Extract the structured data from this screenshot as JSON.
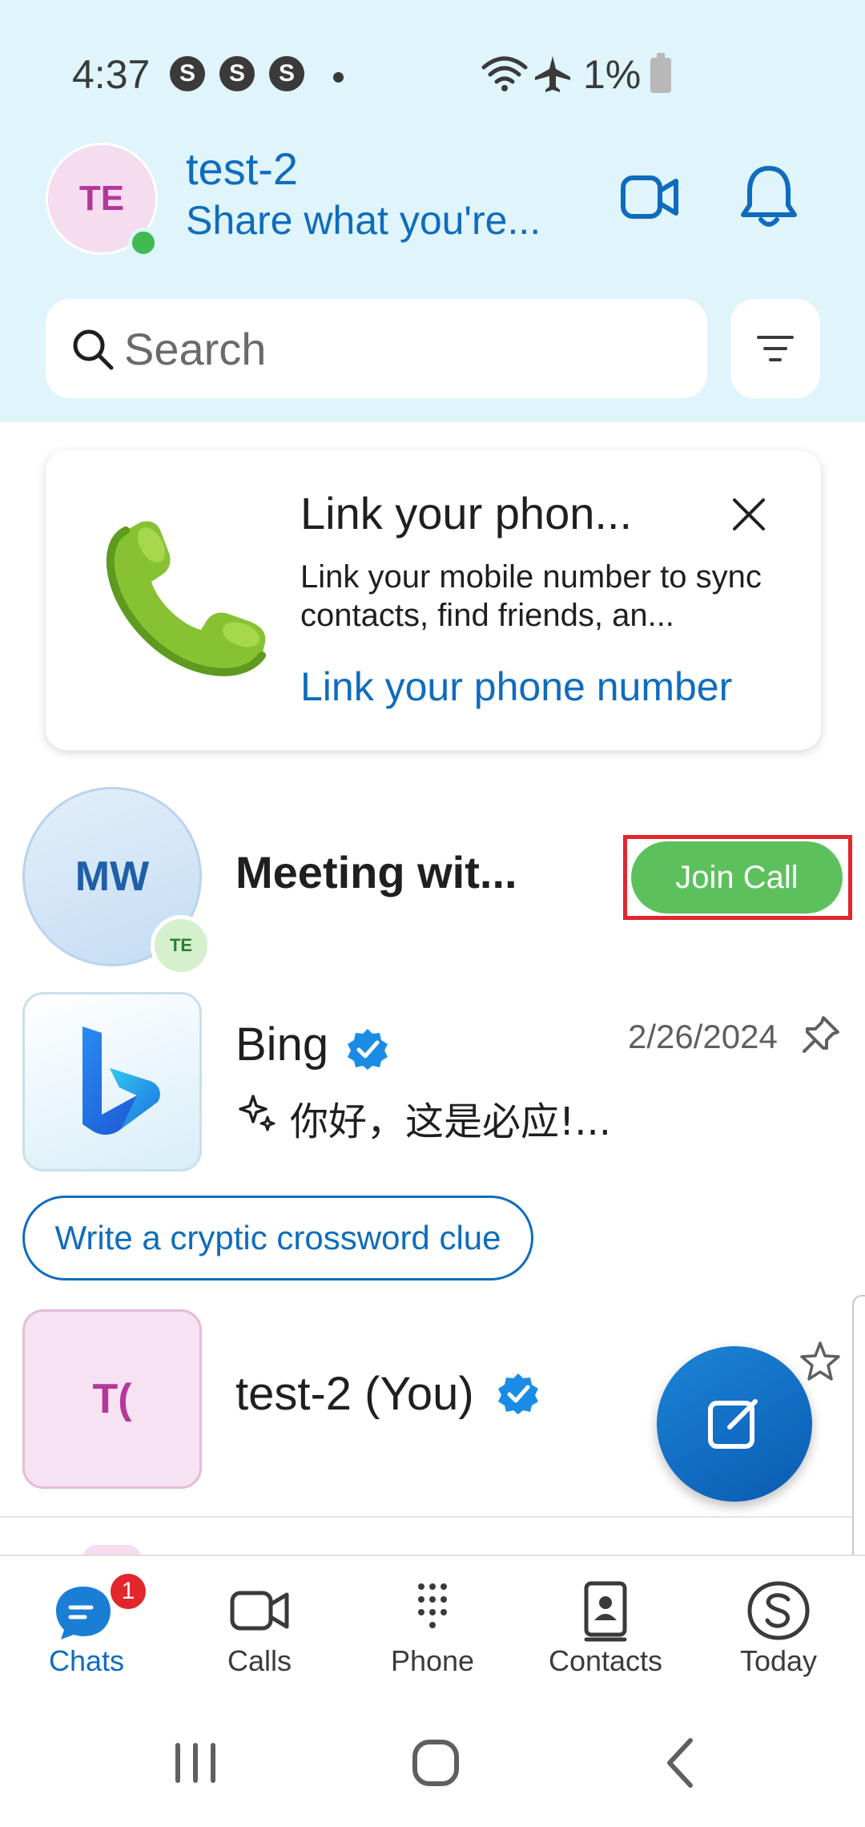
{
  "status_bar": {
    "time": "4:37",
    "app_badges": [
      "S",
      "S",
      "S"
    ],
    "battery": "1%"
  },
  "header": {
    "avatar_initials": "TE",
    "display_name": "test-2",
    "status_message": "Share what you're..."
  },
  "search": {
    "placeholder": "Search"
  },
  "link_card": {
    "title": "Link your phon...",
    "description": "Link your mobile number to sync contacts, find friends, an...",
    "link_label": "Link your phone number"
  },
  "chats": [
    {
      "avatar_initials": "MW",
      "sub_avatar_initials": "TE",
      "title": "Meeting wit...",
      "action_label": "Join Call"
    },
    {
      "title": "Bing",
      "date": "2/26/2024",
      "preview": "你好，这是必应!..."
    },
    {
      "avatar_initials": "T(",
      "title": "test-2 (You)"
    }
  ],
  "suggestion_chip": "Write a cryptic crossword clue",
  "bottom_nav": {
    "items": [
      {
        "label": "Chats",
        "icon": "chat-bubble-icon",
        "badge": "1",
        "active": true
      },
      {
        "label": "Calls",
        "icon": "video-camera-icon"
      },
      {
        "label": "Phone",
        "icon": "dialpad-icon"
      },
      {
        "label": "Contacts",
        "icon": "contacts-book-icon"
      },
      {
        "label": "Today",
        "icon": "skype-logo-icon"
      }
    ]
  },
  "colors": {
    "accent": "#0f6cbd",
    "header_bg": "#dff4fb",
    "join_call": "#5cc15c",
    "highlight": "#e2262c"
  }
}
